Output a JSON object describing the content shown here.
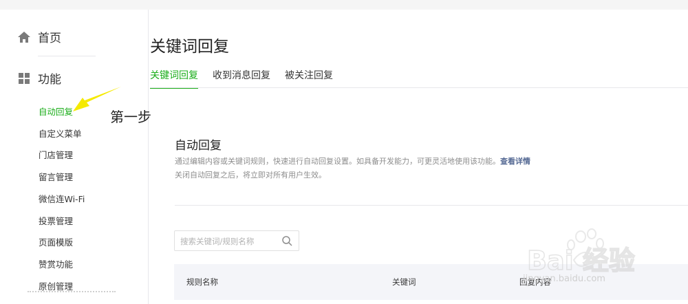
{
  "sidebar": {
    "home_label": "首页",
    "function_label": "功能",
    "items": [
      {
        "label": "自动回复",
        "active": true
      },
      {
        "label": "自定义菜单",
        "active": false
      },
      {
        "label": "门店管理",
        "active": false
      },
      {
        "label": "留言管理",
        "active": false
      },
      {
        "label": "微信连Wi-Fi",
        "active": false
      },
      {
        "label": "投票管理",
        "active": false
      },
      {
        "label": "页面模版",
        "active": false
      },
      {
        "label": "赞赏功能",
        "active": false
      },
      {
        "label": "原创管理",
        "active": false
      }
    ]
  },
  "annotation": {
    "step_label": "第一步",
    "arrow_color": "#f5ea00"
  },
  "header": {
    "title": "关键词回复",
    "tabs": [
      {
        "label": "关键词回复",
        "active": true
      },
      {
        "label": "收到消息回复",
        "active": false
      },
      {
        "label": "被关注回复",
        "active": false
      }
    ]
  },
  "content": {
    "title": "自动回复",
    "description": "通过编辑内容或关键词规则，快速进行自动回复设置。如具备开发能力，可更灵活地使用该功能。",
    "link_label": "查看详情",
    "note": "关闭自动回复之后，将立即对所有用户生效。",
    "search": {
      "placeholder": "搜索关键词/规则名称",
      "value": ""
    },
    "table_columns": [
      "规则名称",
      "关键词",
      "回复内容"
    ]
  },
  "watermark": {
    "logo_text": "Bai 经验",
    "url": "jingyan.baidu.com"
  },
  "colors": {
    "accent": "#1aad19",
    "link": "#576b95",
    "muted": "#8d8d8d"
  }
}
